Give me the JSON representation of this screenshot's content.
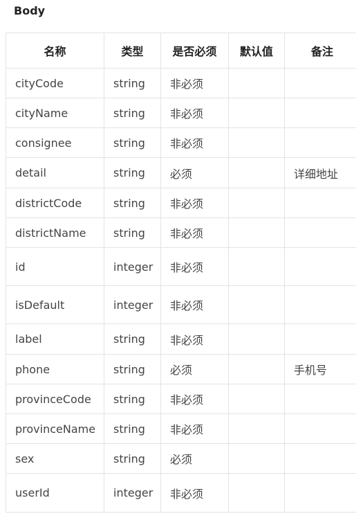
{
  "section": {
    "title": "Body"
  },
  "table": {
    "headers": [
      "名称",
      "类型",
      "是否必须",
      "默认值",
      "备注"
    ],
    "rows": [
      {
        "name": "cityCode",
        "type": "string",
        "required": "非必须",
        "default": "",
        "note": "",
        "h": 43
      },
      {
        "name": "cityName",
        "type": "string",
        "required": "非必须",
        "default": "",
        "note": "",
        "h": 43
      },
      {
        "name": "consignee",
        "type": "string",
        "required": "非必须",
        "default": "",
        "note": "",
        "h": 43
      },
      {
        "name": "detail",
        "type": "string",
        "required": "必须",
        "default": "",
        "note": "详细地址",
        "h": 44
      },
      {
        "name": "districtCode",
        "type": "string",
        "required": "非必须",
        "default": "",
        "note": "",
        "h": 43
      },
      {
        "name": "districtName",
        "type": "string",
        "required": "非必须",
        "default": "",
        "note": "",
        "h": 43
      },
      {
        "name": "id",
        "type": "integer",
        "required": "非必须",
        "default": "",
        "note": "",
        "h": 55
      },
      {
        "name": "isDefault",
        "type": "integer",
        "required": "非必须",
        "default": "",
        "note": "",
        "h": 55
      },
      {
        "name": "label",
        "type": "string",
        "required": "非必须",
        "default": "",
        "note": "",
        "h": 44
      },
      {
        "name": "phone",
        "type": "string",
        "required": "必须",
        "default": "",
        "note": "手机号",
        "h": 43
      },
      {
        "name": "provinceCode",
        "type": "string",
        "required": "非必须",
        "default": "",
        "note": "",
        "h": 43
      },
      {
        "name": "provinceName",
        "type": "string",
        "required": "非必须",
        "default": "",
        "note": "",
        "h": 43
      },
      {
        "name": "sex",
        "type": "string",
        "required": "必须",
        "default": "",
        "note": "",
        "h": 43
      },
      {
        "name": "userId",
        "type": "integer",
        "required": "非必须",
        "default": "",
        "note": "",
        "h": 56
      }
    ]
  }
}
